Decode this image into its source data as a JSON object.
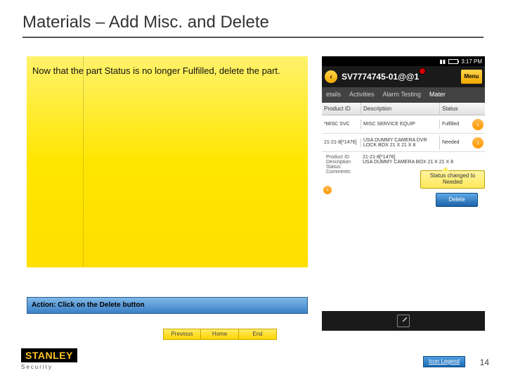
{
  "title": "Materials – Add Misc. and Delete",
  "instruction": "Now that the part Status is no longer Fulfilled, delete the part.",
  "action_text": "Action: Click on the Delete button",
  "device": {
    "statusbar": {
      "time": "3:17 PM"
    },
    "appbar": {
      "back": "‹",
      "title": "SV7774745-01@@1",
      "menu": "Menu"
    },
    "tabs": [
      "etails",
      "Activities",
      "Alarm Testing",
      "Mater"
    ],
    "active_tab": 3,
    "columns": [
      "Product ID",
      "Description",
      "Status"
    ],
    "rows": [
      {
        "id": "*MISC SVC",
        "desc": "MISC SERVICE EQUIP",
        "status": "Fulfilled"
      },
      {
        "id": "21-21-8[*1476]",
        "desc": "USA DUMMY CAMERA DVR LOCK BOX 21 X 21 X 8",
        "status": "Needed"
      }
    ],
    "details": {
      "product_id_label": "Product ID",
      "product_id": "21-21-8[*1476]",
      "description_label": "Description",
      "description": "USA DUMMY CAMERA BOX 21 X 21 X 8",
      "status_label": "Status:",
      "comments_label": "Comments:"
    },
    "delete_label": "Delete"
  },
  "callout": "Status changed to Needed",
  "nav": {
    "previous": "Previous",
    "home": "Home",
    "end": "End"
  },
  "footer": {
    "brand": "STANLEY",
    "sub": "Security",
    "legend": "Icon Legend",
    "page": "14"
  }
}
